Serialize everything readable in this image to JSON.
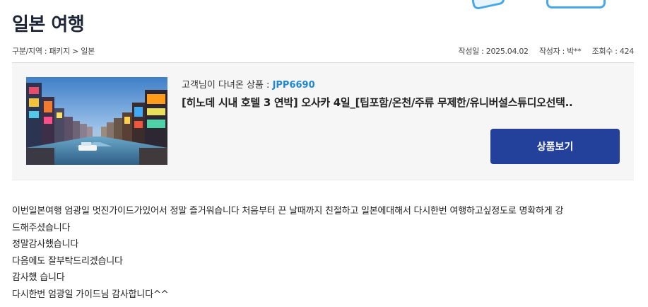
{
  "page": {
    "title": "일본 여행"
  },
  "meta": {
    "breadcrumb": "구분/지역 : 패키지 > 일본",
    "date": "작성일 : 2025.04.02",
    "author": "작성자 : 박**",
    "views": "조회수 : 424"
  },
  "product": {
    "subtitle_label": "고객님이 다녀온 상품 : ",
    "code": "JPP6690",
    "name": "[히노데 시내 호텔 3 연박] 오사카 4일_[팁포함/온천/주류 무제한/유니버설스튜디오선택..",
    "button_label": "상품보기",
    "image_icon": "osaka-canal-photo"
  },
  "content": {
    "lines": [
      "이번일본여행  엄광일 멋진가이드가있어서 정말 즐거워습니다  처음부터 끈 날때까지  친절하고  일본에대해서 다시한번 여행하고싶정도로 명확하게 강",
      "드해주셨습니다",
      "정말감사했습니다",
      "다음에도  잘부탁드리겠습니다",
      "감사했 습니다",
      "다시한번  엄광일 가이드님 감사합니다^^"
    ]
  },
  "colors": {
    "accent": "#23409a",
    "code": "#1f88d4",
    "deco": "#4aa8e8"
  }
}
